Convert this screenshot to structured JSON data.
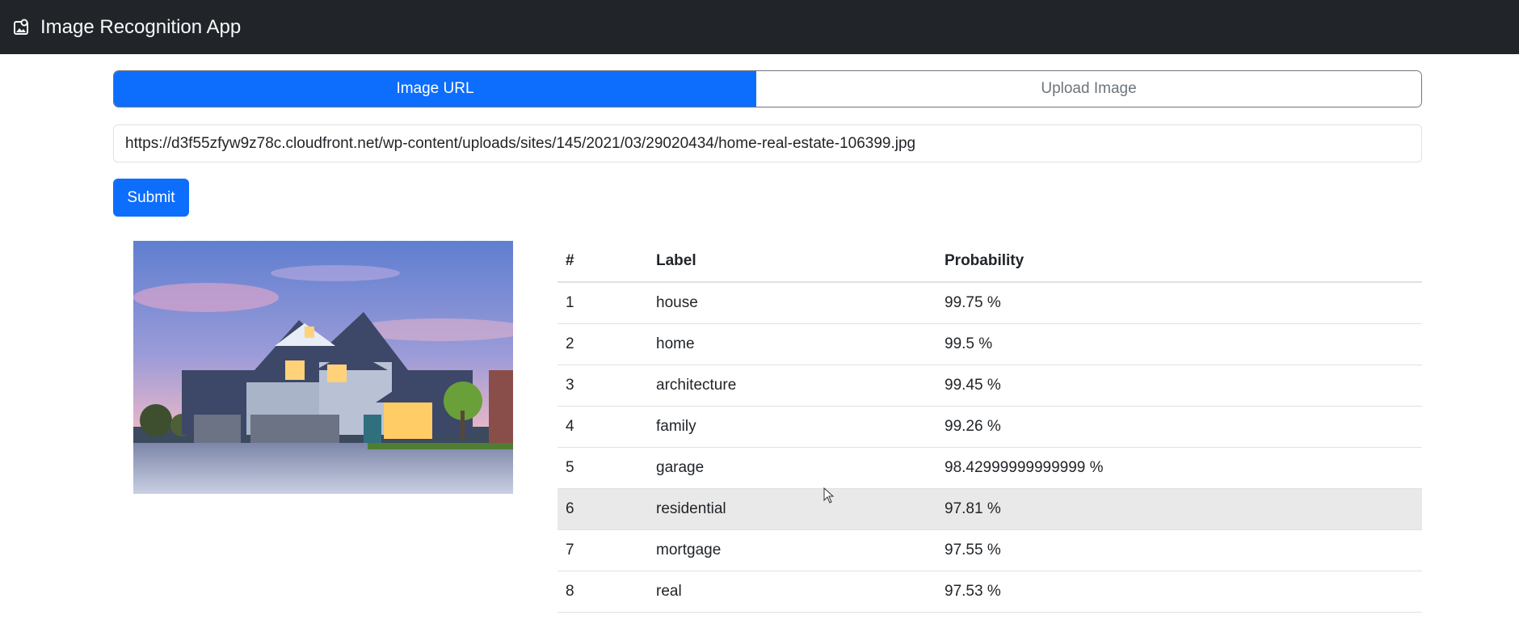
{
  "navbar": {
    "title": "Image Recognition App",
    "icon": "image-icon"
  },
  "tabs": [
    {
      "label": "Image URL",
      "active": true
    },
    {
      "label": "Upload Image",
      "active": false
    }
  ],
  "url_input": {
    "value": "https://d3f55zfyw9z78c.cloudfront.net/wp-content/uploads/sites/145/2021/03/29020434/home-real-estate-106399.jpg"
  },
  "submit": {
    "label": "Submit"
  },
  "results": {
    "headers": [
      "#",
      "Label",
      "Probability"
    ],
    "rows": [
      {
        "num": "1",
        "label": "house",
        "probability": "99.75 %"
      },
      {
        "num": "2",
        "label": "home",
        "probability": "99.5 %"
      },
      {
        "num": "3",
        "label": "architecture",
        "probability": "99.45 %"
      },
      {
        "num": "4",
        "label": "family",
        "probability": "99.26 %"
      },
      {
        "num": "5",
        "label": "garage",
        "probability": "98.42999999999999 %"
      },
      {
        "num": "6",
        "label": "residential",
        "probability": "97.81 %",
        "hovered": true
      },
      {
        "num": "7",
        "label": "mortgage",
        "probability": "97.55 %"
      },
      {
        "num": "8",
        "label": "real",
        "probability": "97.53 %"
      }
    ]
  },
  "colors": {
    "primary": "#0d6efd",
    "navbar_bg": "#212529",
    "row_hover": "#e9e9e9"
  }
}
